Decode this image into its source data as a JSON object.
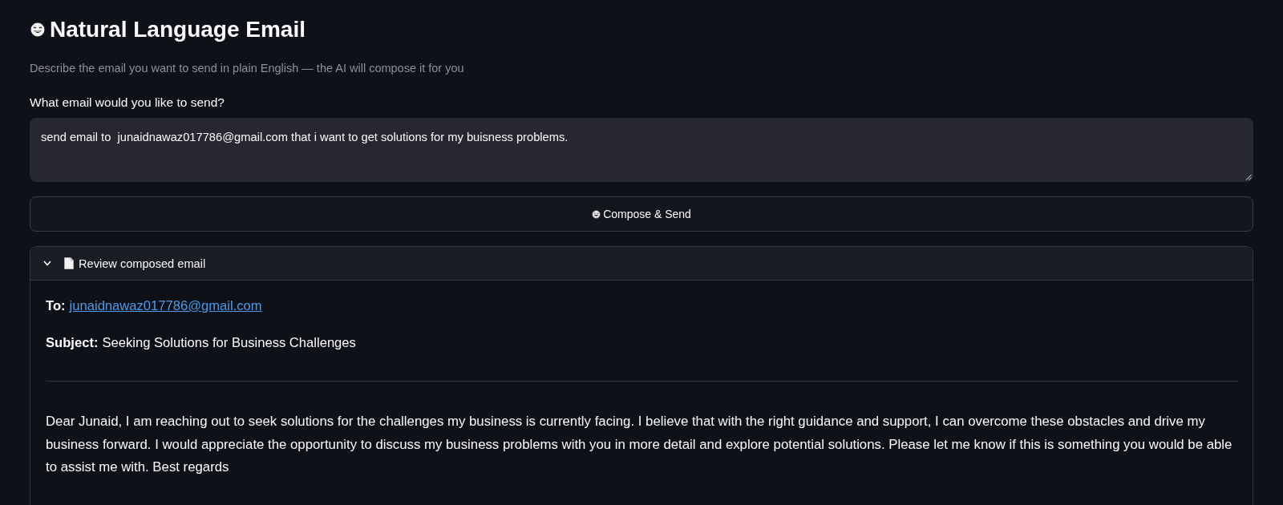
{
  "header": {
    "title": "Natural Language Email",
    "subtitle": "Describe the email you want to send in plain English — the AI will compose it for you"
  },
  "prompt_field": {
    "label": "What email would you like to send?",
    "value": "send email to  junaidnawaz017786@gmail.com that i want to get solutions for my buisness problems."
  },
  "compose_button": {
    "label": "Compose & Send"
  },
  "review_expander": {
    "title": "Review composed email",
    "expanded": true,
    "fields": [
      {
        "kind": "link",
        "label": "To:",
        "value": "junaidnawaz017786@gmail.com"
      },
      {
        "kind": "text",
        "label": "Subject:",
        "value": "Seeking Solutions for Business Challenges"
      }
    ],
    "body": "Dear Junaid, I am reaching out to seek solutions for the challenges my business is currently facing. I believe that with the right guidance and support, I can overcome these obstacles and drive my business forward. I would appreciate the opportunity to discuss my business problems with you in more detail and explore potential solutions. Please let me know if this is something you would be able to assist me with. Best regards"
  }
}
